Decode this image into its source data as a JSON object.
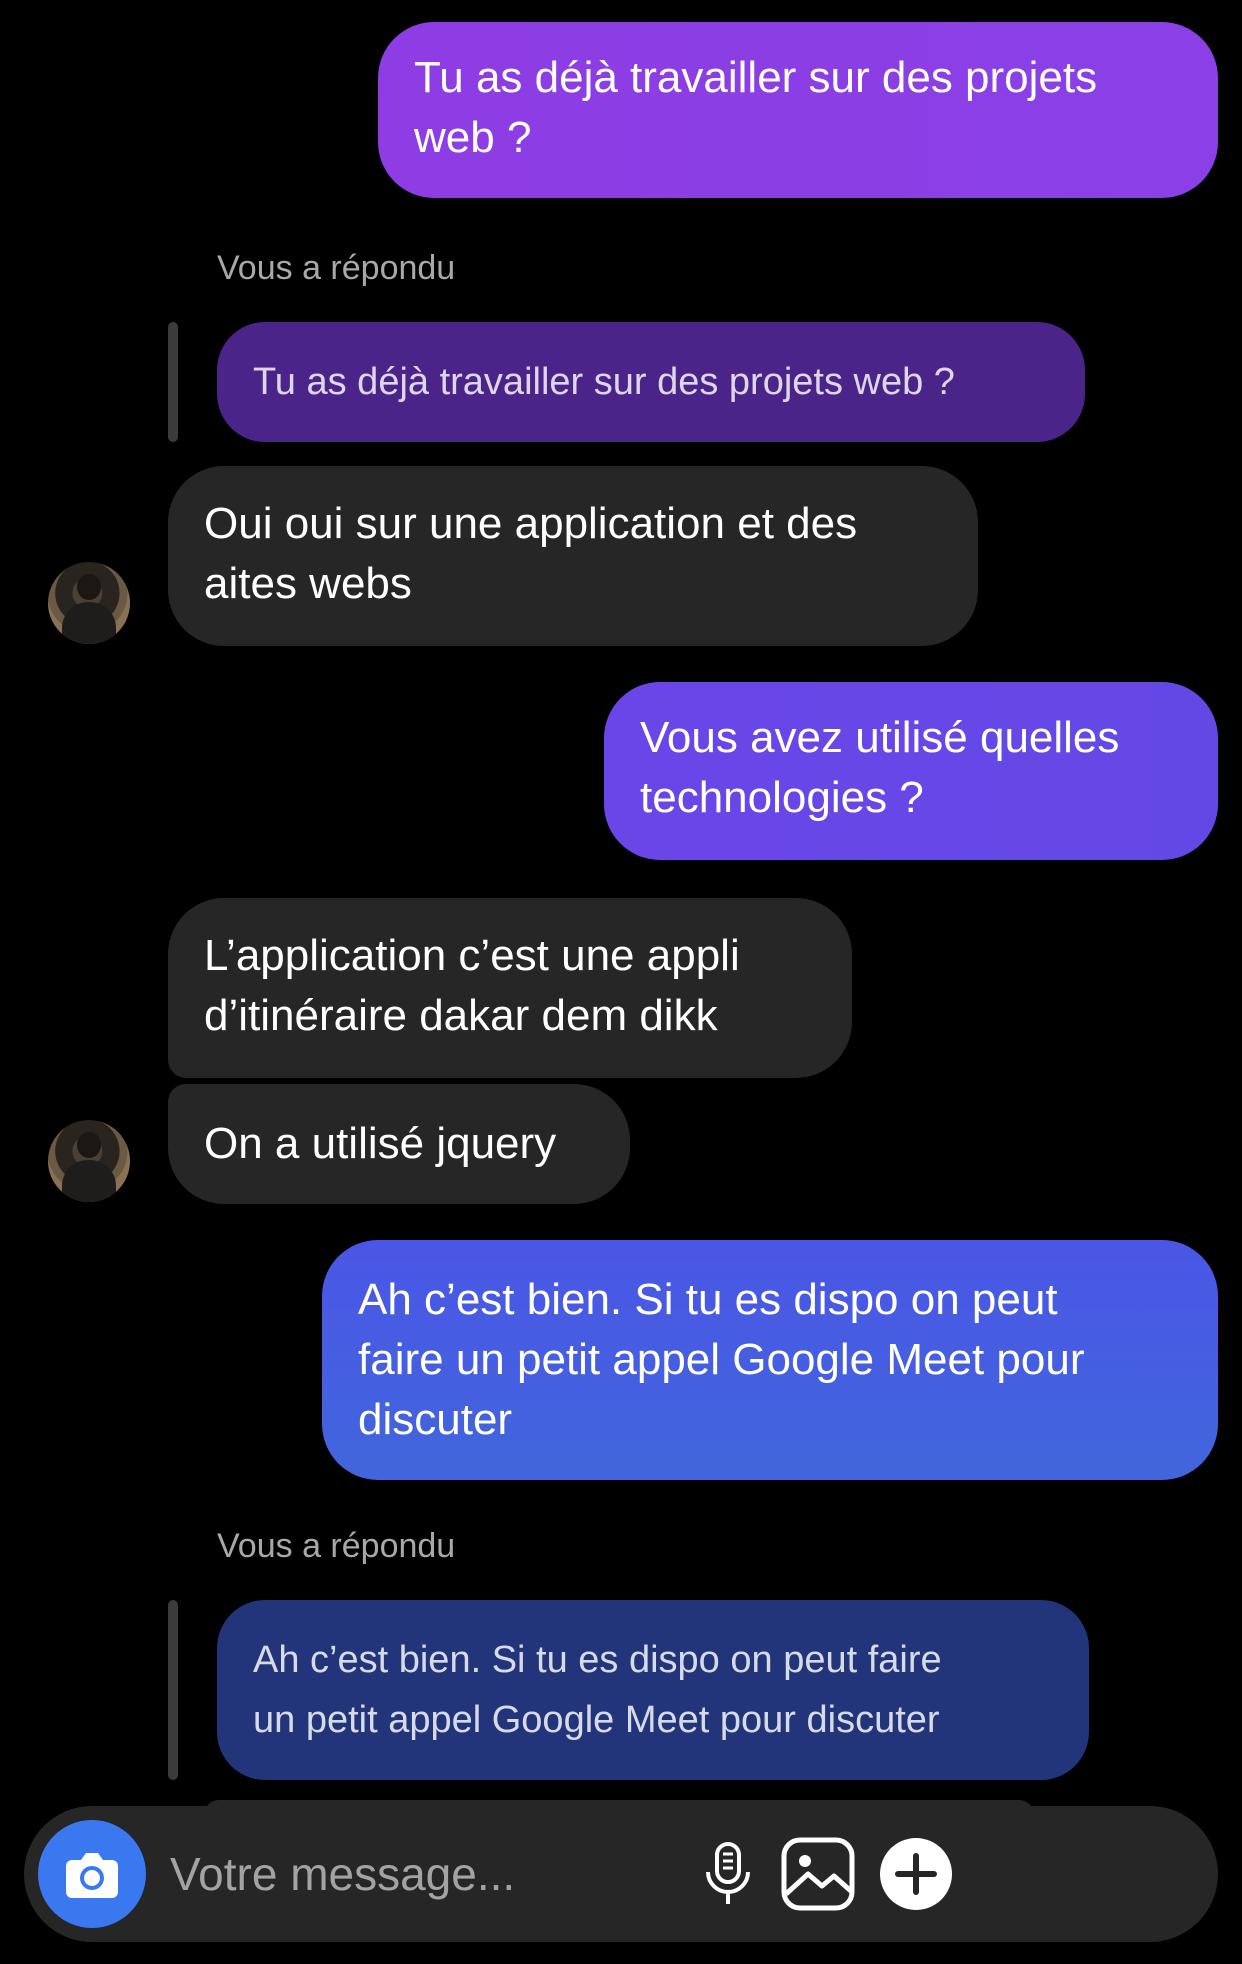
{
  "messages": {
    "m1": {
      "line1": "Tu as déjà travailler sur des projets",
      "line2": "web ?"
    },
    "reply1": {
      "label": "Vous a répondu",
      "quote": "Tu as déjà travailler sur des projets web ?"
    },
    "m2": {
      "line1": "Oui oui sur une application et des",
      "line2": "aites webs"
    },
    "m3": {
      "line1": "Vous avez utilisé quelles",
      "line2": "technologies ?"
    },
    "m4": {
      "line1": "L’application c’est une appli",
      "line2": "d’itinéraire dakar dem dikk"
    },
    "m5": {
      "line1": "On a utilisé jquery"
    },
    "m6": {
      "line1": "Ah c’est bien. Si tu es dispo on peut",
      "line2": "faire un petit appel Google Meet pour",
      "line3": "discuter"
    },
    "reply2": {
      "label": "Vous a répondu",
      "quote_line1": "Ah c’est bien. Si tu es dispo on peut faire",
      "quote_line2": "un petit appel Google Meet pour discuter"
    }
  },
  "composer": {
    "placeholder": "Votre message...",
    "icons": [
      "camera-icon",
      "microphone-icon",
      "gallery-icon",
      "plus-icon"
    ]
  },
  "colors": {
    "background": "#000000",
    "outgoing_top": "#8e3ce4",
    "outgoing_bottom": "#4166dc",
    "incoming": "#262626",
    "camera_button": "#3a78f0"
  }
}
